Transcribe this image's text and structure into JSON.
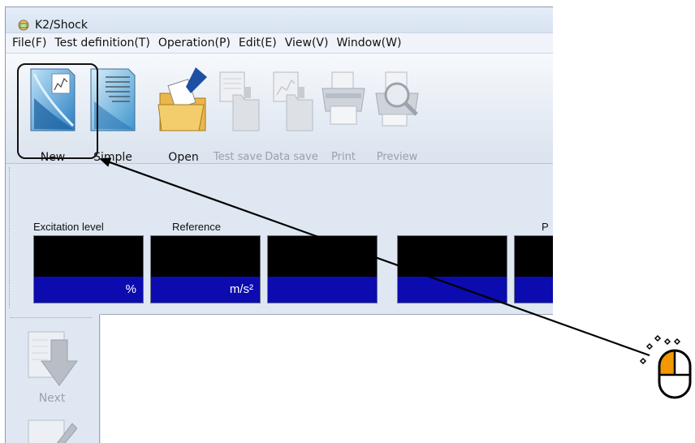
{
  "window": {
    "title": "K2/Shock",
    "app_icon": "k2-shock-app-icon"
  },
  "menu": [
    {
      "label": "File(F)"
    },
    {
      "label": "Test definition(T)"
    },
    {
      "label": "Operation(P)"
    },
    {
      "label": "Edit(E)"
    },
    {
      "label": "View(V)"
    },
    {
      "label": "Window(W)"
    }
  ],
  "toolbar": {
    "buttons": [
      {
        "label": "New",
        "icon": "new-document-icon",
        "enabled": true
      },
      {
        "label": "Simple",
        "icon": "simple-document-icon",
        "enabled": true
      },
      {
        "label": "Open",
        "icon": "open-folder-icon",
        "enabled": true
      },
      {
        "label": "Test save",
        "icon": "test-save-icon",
        "enabled": false
      },
      {
        "label": "Data save",
        "icon": "data-save-icon",
        "enabled": false
      },
      {
        "label": "Print",
        "icon": "printer-icon",
        "enabled": false
      },
      {
        "label": "Preview",
        "icon": "preview-icon",
        "enabled": false
      }
    ]
  },
  "panel": {
    "excitation_label": "Excitation level",
    "reference_label": "Reference",
    "partial_label": "P",
    "meters": [
      {
        "unit": "%"
      },
      {
        "unit": "m/s²"
      },
      {
        "unit": ""
      },
      {
        "unit": ""
      },
      {
        "unit": ""
      }
    ]
  },
  "side_toolbar": {
    "next_label": "Next",
    "next_icon": "next-arrow-icon"
  },
  "annotation": {
    "pointer_icon": "mouse-left-click-icon",
    "highlight_color": "#111111",
    "click_color": "#f39800"
  },
  "colors": {
    "meter_value_bg": "#000000",
    "meter_unit_bg": "#0b0bb0"
  }
}
